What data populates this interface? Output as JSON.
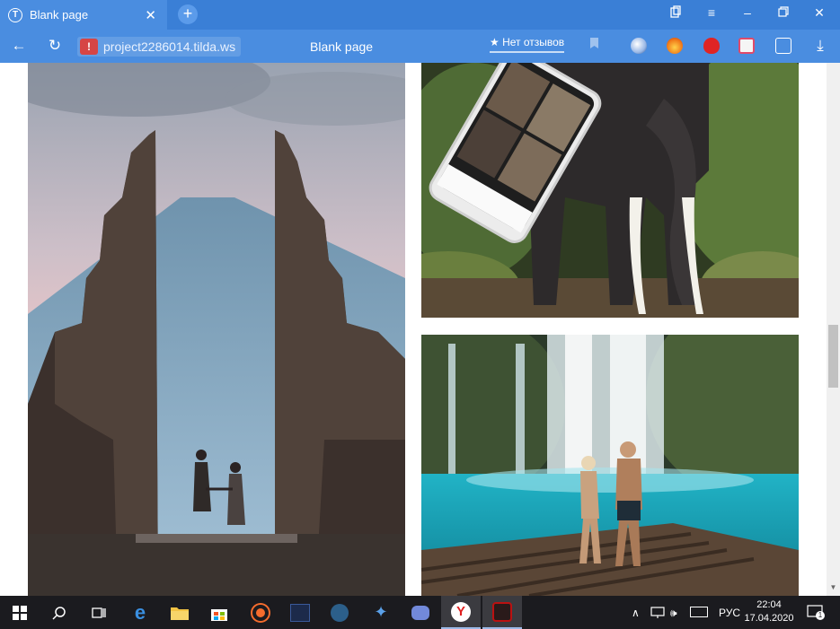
{
  "browser": {
    "tab": {
      "title": "Blank page",
      "favicon": "tilda-favicon-icon"
    },
    "window_controls": [
      "bookmarks-panel-icon",
      "menu-icon",
      "minimize-icon",
      "restore-icon",
      "close-icon"
    ],
    "address": {
      "security_icon": "warning-icon",
      "url": "project2286014.tilda.ws",
      "page_title": "Blank page",
      "reviews_label": "★ Нет отзывов"
    },
    "extensions": [
      "vpn-extension-icon",
      "fire-extension-icon",
      "adblock-extension-icon",
      "cat-extension-icon",
      "translate-extension-icon",
      "download-icon"
    ]
  },
  "page": {
    "images": [
      {
        "name": "temple-gate-couple-photo",
        "subject": "Bali temple gate with couple at sunset"
      },
      {
        "name": "elephant-phone-photo",
        "subject": "Elephant in jungle with phone mockup"
      },
      {
        "name": "waterfall-couple-photo",
        "subject": "Couple on raft at turquoise waterfall"
      }
    ]
  },
  "taskbar": {
    "apps": [
      "start-icon",
      "search-icon",
      "task-view-icon",
      "edge-icon",
      "file-explorer-icon",
      "store-icon",
      "origin-icon",
      "terminal-icon",
      "steam-icon",
      "visual-studio-icon",
      "discord-icon",
      "yandex-browser-icon",
      "game-icon"
    ],
    "tray": {
      "language": "РУС",
      "time": "22:04",
      "date": "17.04.2020",
      "notifications": "1"
    }
  }
}
